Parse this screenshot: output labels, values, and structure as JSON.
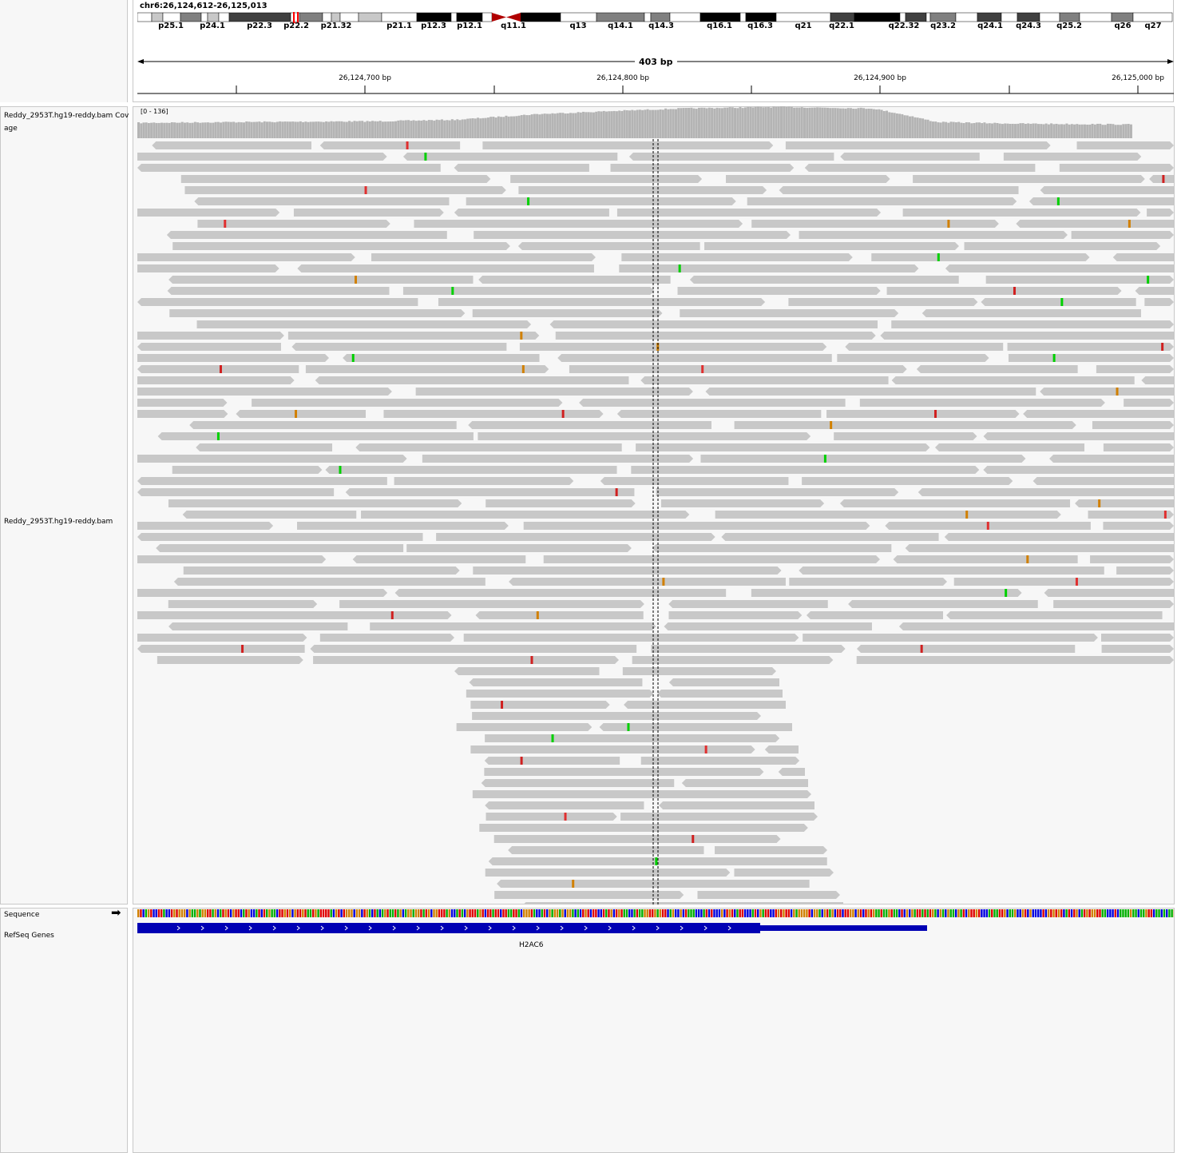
{
  "locus": "chr6:26,124,612-26,125,013",
  "ideogram": {
    "bands": [
      "p25.1",
      "p24.1",
      "p22.3",
      "p22.2",
      "p21.32",
      "p21.1",
      "p12.3",
      "p12.1",
      "q11.1",
      "q13",
      "q14.1",
      "q14.3",
      "q16.1",
      "q16.3",
      "q21",
      "q22.1",
      "q22.32",
      "q23.2",
      "q24.1",
      "q24.3",
      "q25.2",
      "q26",
      "q27"
    ]
  },
  "ruler": {
    "span_label": "403 bp",
    "tick_labels": [
      "26,124,700 bp",
      "26,124,800 bp",
      "26,124,900 bp",
      "26,125,000 bp"
    ]
  },
  "tracks": {
    "coverage_name": "Reddy_2953T.hg19-reddy.bam Cov",
    "coverage_name_wrap": "age",
    "coverage_range": "[0 - 136]",
    "alignment_name": "Reddy_2953T.hg19-reddy.bam",
    "sequence_name": "Sequence",
    "sequence_arrow": "➡",
    "refseq_name": "RefSeq Genes",
    "gene_name": "H2AC6"
  },
  "colors": {
    "read": "#c8c8c8",
    "coverage": "#b4b4b4",
    "gene": "#0000b4",
    "mismatch_A": "#00d000",
    "mismatch_C": "#e03030",
    "mismatch_G": "#d18000",
    "mismatch_T": "#d02020"
  }
}
